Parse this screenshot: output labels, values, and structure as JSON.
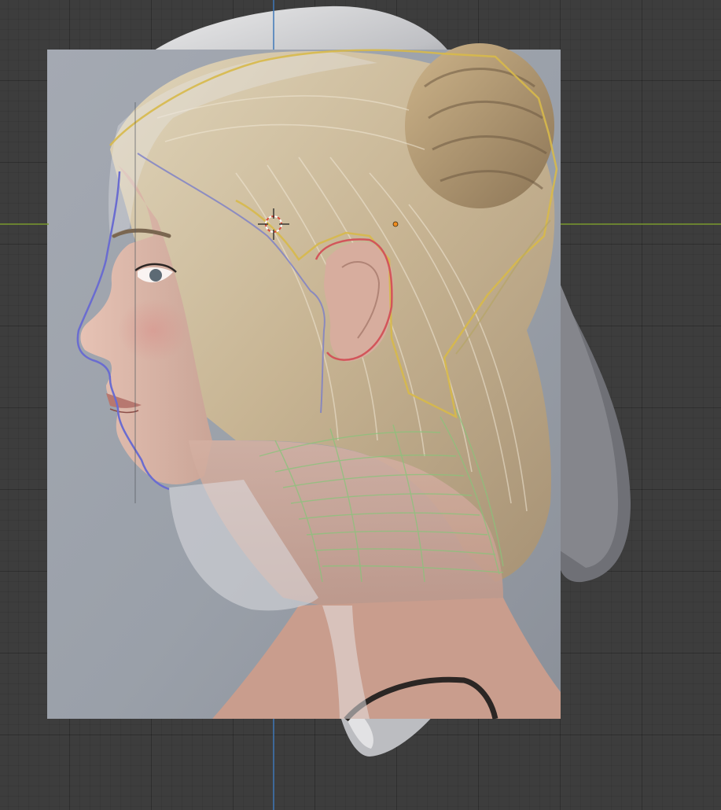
{
  "viewport": {
    "background_color": "#3d3d3d",
    "grid_line_color": "#2f2f2f",
    "axis_x_color": "#7a9a2e",
    "axis_y_color": "#3f78b8"
  },
  "reference_image": {
    "subject": "side-profile-portrait",
    "backdrop_color": "#9ea4ad"
  },
  "mesh": {
    "color": "#d6d6d8",
    "shade_color": "#8d8e93"
  },
  "retopology_outlines": {
    "face_color": "#6a6cd0",
    "hairline_color": "#d7b94a",
    "ear_color": "#d2555a",
    "neck_color": "#88c47a"
  },
  "icons": {
    "cursor": "3d-cursor-icon",
    "origin": "object-origin-icon"
  }
}
